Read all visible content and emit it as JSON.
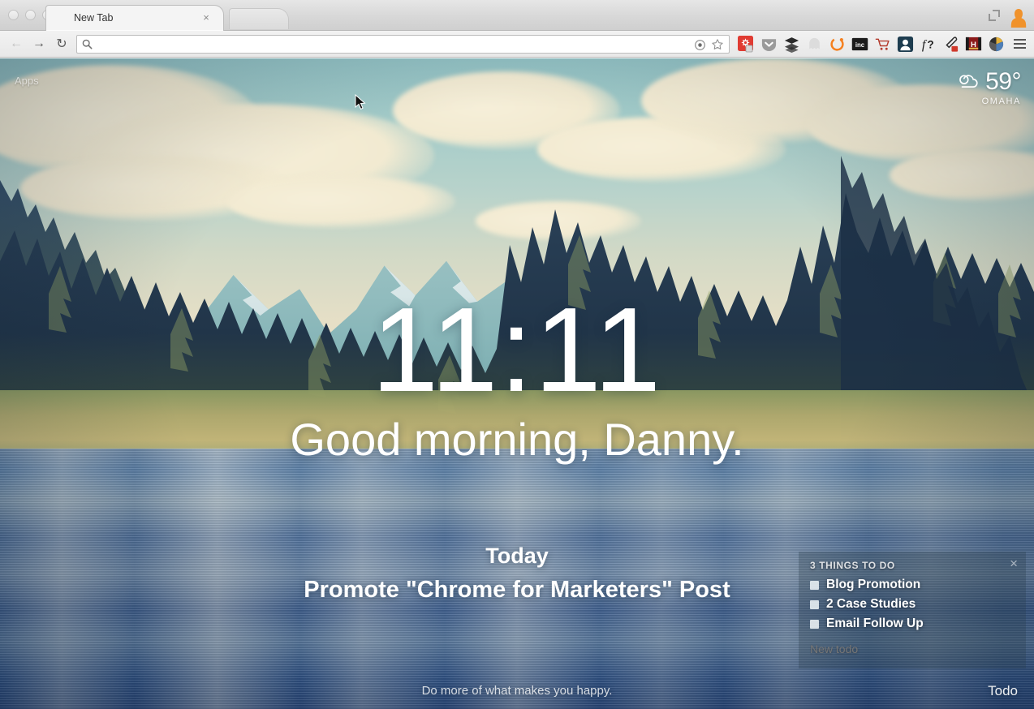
{
  "browser": {
    "window_controls": [
      "close",
      "minimize",
      "zoom"
    ],
    "tab": {
      "title": "New Tab",
      "close_label": "×"
    },
    "nav": {
      "back_label": "←",
      "forward_label": "→",
      "reload_label": "↻"
    },
    "omnibox": {
      "value": "",
      "placeholder": "",
      "search_icon": "search-icon",
      "bookmark_icon": "star-icon",
      "target_icon": "target-icon"
    },
    "extensions": [
      {
        "name": "evernote-web-clipper",
        "label": "✻",
        "fg": "#ffffff",
        "bg": "#e03b32"
      },
      {
        "name": "pocket-save",
        "label": "▼",
        "fg": "#ffffff",
        "bg": "#8d8d8d"
      },
      {
        "name": "buffer",
        "label": "≡",
        "fg": "#2a2a2a",
        "bg": "transparent"
      },
      {
        "name": "ghostery",
        "label": "●",
        "fg": "#d8d8d8",
        "bg": "transparent"
      },
      {
        "name": "hubspot-sprocket",
        "label": "◌",
        "fg": "#f5801f",
        "bg": "transparent"
      },
      {
        "name": "inc-magazine",
        "label": "inc",
        "fg": "#ffffff",
        "bg": "#1c1c1c"
      },
      {
        "name": "shopping-cart",
        "label": "Ὥ2",
        "fg": "#c0392b",
        "bg": "transparent"
      },
      {
        "name": "rapportive",
        "label": "◆",
        "fg": "#ffffff",
        "bg": "#1d3c4f"
      },
      {
        "name": "function-help",
        "label": "ƒ?",
        "fg": "#1c1c1c",
        "bg": "transparent"
      },
      {
        "name": "eyedropper",
        "label": "✒",
        "fg": "#2b2b2b",
        "bg": "transparent"
      },
      {
        "name": "hubspot-sales",
        "label": "H",
        "fg": "#ffffff",
        "bg": "#8b1a1a"
      },
      {
        "name": "color-wheel",
        "label": "●",
        "fg": "#2b2b2b",
        "bg": "transparent"
      }
    ],
    "menu_label": "chrome-menu",
    "fullscreen_label": "fullscreen",
    "avatar_label": "profile-avatar",
    "avatar_color": "#f0922b"
  },
  "newtab": {
    "apps_label": "Apps",
    "weather": {
      "temperature": "59°",
      "city": "OMAHA",
      "icon": "cloud-icon"
    },
    "clock": "11:11",
    "greeting": "Good morning, Danny.",
    "focus": {
      "label": "Today",
      "task": "Promote \"Chrome for Marketers\" Post"
    },
    "tagline": "Do more of what makes you happy.",
    "todo_link": "Todo",
    "todo_panel": {
      "heading": "3 THINGS TO DO",
      "close_label": "×",
      "items": [
        {
          "text": "Blog Promotion",
          "done": false
        },
        {
          "text": "2 Case Studies",
          "done": false
        },
        {
          "text": "Email Follow Up",
          "done": false
        }
      ],
      "new_placeholder": "New todo"
    }
  },
  "colors": {
    "sky_top": "#93c2c4",
    "sky_bottom": "#efe3c6",
    "cloud": "#f2ead1",
    "mountain": "#7fb0b4",
    "tree_dark": "#1e3348",
    "tree_light": "#7b8f5c",
    "grass": "#b2ab6f",
    "water_deep": "#2b4a7d",
    "text_white": "#ffffff",
    "accent_orange": "#f0922b"
  }
}
